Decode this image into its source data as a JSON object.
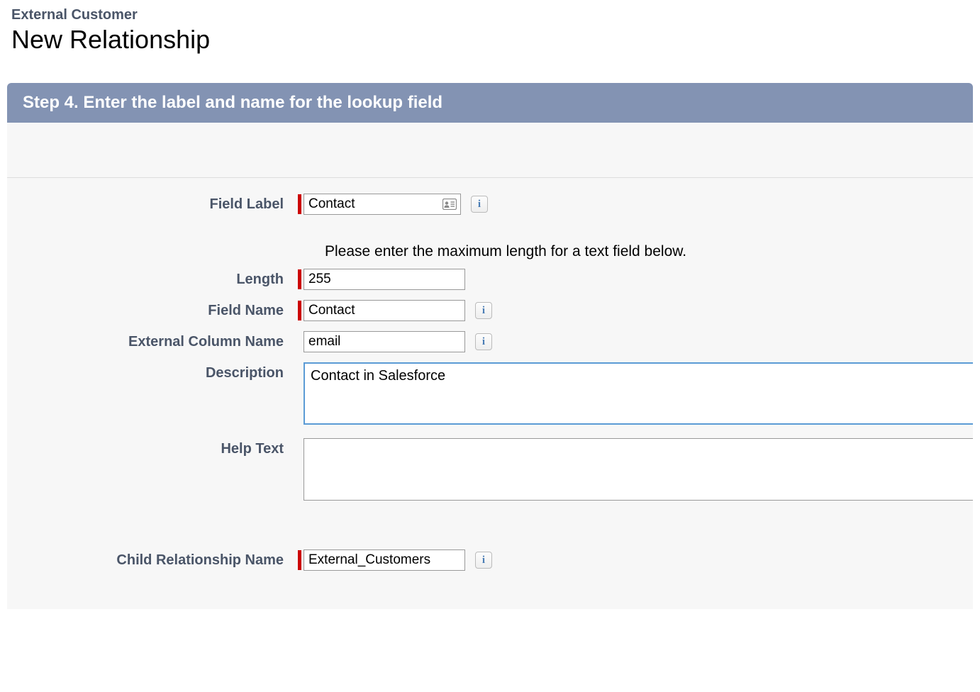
{
  "header": {
    "breadcrumb": "External Customer",
    "title": "New Relationship"
  },
  "step": {
    "title": "Step 4. Enter the label and name for the lookup field"
  },
  "form": {
    "field_label": {
      "label": "Field Label",
      "value": "Contact"
    },
    "instruction": "Please enter the maximum length for a text field below.",
    "length": {
      "label": "Length",
      "value": "255"
    },
    "field_name": {
      "label": "Field Name",
      "value": "Contact"
    },
    "external_column_name": {
      "label": "External Column Name",
      "value": "email"
    },
    "description": {
      "label": "Description",
      "value": "Contact in Salesforce"
    },
    "help_text": {
      "label": "Help Text",
      "value": ""
    },
    "child_relationship_name": {
      "label": "Child Relationship Name",
      "value": "External_Customers"
    }
  }
}
